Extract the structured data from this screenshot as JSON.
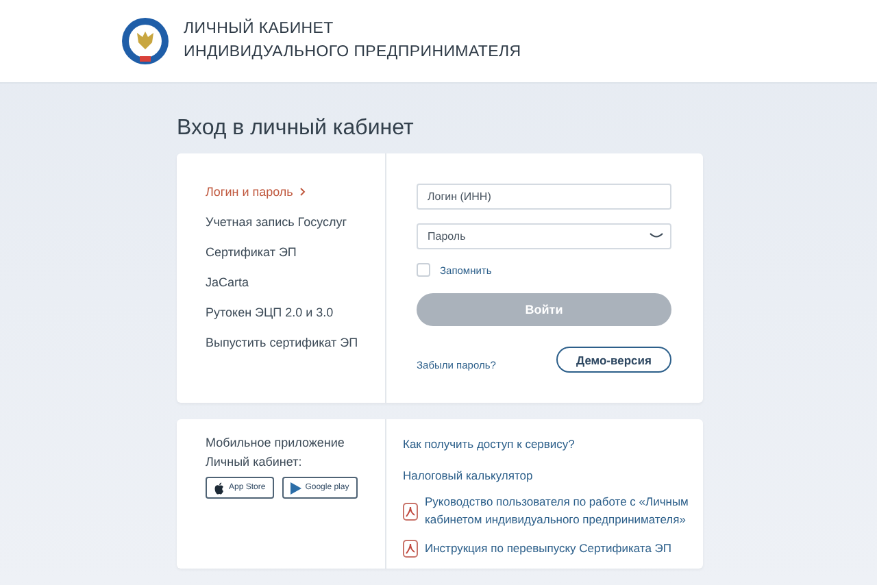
{
  "header": {
    "title_lines": [
      "ЛИЧНЫЙ КАБИНЕТ",
      "ИНДИВИДУАЛЬНОГО ПРЕДПРИНИМАТЕЛЯ"
    ]
  },
  "login": {
    "heading": "Вход в личный кабинет",
    "methods": [
      {
        "label": "Логин и пароль",
        "selected": true
      },
      {
        "label": "Учетная запись Госуслуг",
        "selected": false
      },
      {
        "label": "Сертификат ЭП",
        "selected": false
      },
      {
        "label": "JaCarta",
        "selected": false
      },
      {
        "label": "Рутокен ЭЦП 2.0 и 3.0",
        "selected": false
      },
      {
        "label": "Выпустить сертификат ЭП",
        "selected": false
      }
    ],
    "login_placeholder": "Логин (ИНН)",
    "password_placeholder": "Пароль",
    "remember": {
      "label": "Запомнить",
      "checked": false
    },
    "submit": {
      "label": "Войти",
      "disabled": true
    },
    "forgot_link": "Забыли пароль?",
    "demo_button": "Демо-версия"
  },
  "info": {
    "app_lines": [
      "Мобильное приложение",
      "Личный кабинет:"
    ],
    "stores": [
      {
        "kind": "apple",
        "label": "App Store"
      },
      {
        "kind": "google",
        "label": "Google play"
      }
    ],
    "links": [
      {
        "kind": "link",
        "label": "Как получить доступ к сервису?"
      },
      {
        "kind": "link",
        "label": "Налоговый калькулятор"
      },
      {
        "kind": "pdf",
        "label": "Руководство пользователя по работе с «Личным кабинетом индивидуального предпринимателя»"
      },
      {
        "kind": "pdf",
        "label": "Инструкция по перевыпуску Сертификата ЭП"
      }
    ]
  }
}
